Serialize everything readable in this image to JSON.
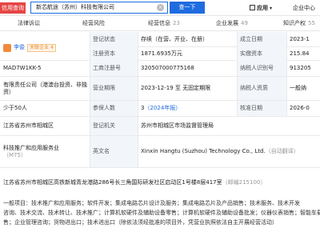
{
  "topbar": {
    "logo": "信用查询",
    "search_value": "新芯航途（苏州）科技有限公司",
    "clear_icon": "×",
    "search_button": "查一下",
    "app_label": "应用",
    "enterprise_center": "企业中心"
  },
  "tabs": [
    {
      "label": "法律诉讼",
      "count": ""
    },
    {
      "label": "经营风险",
      "count": ""
    },
    {
      "label": "经营信息",
      "count": "23"
    },
    {
      "label": "企业发展",
      "count": "49"
    },
    {
      "label": "知识产权",
      "count": "55"
    }
  ],
  "info": {
    "legal_rep": {
      "name": "李俊",
      "link": "关联企业",
      "count": "4"
    },
    "reg_status": {
      "label": "登记状态",
      "value": "存续（在营、开业、在册）"
    },
    "est_date": {
      "label": "成立日期",
      "value": "2023-1"
    },
    "reg_capital": {
      "label": "注册资本",
      "value": "1871.6935万元"
    },
    "paid_capital": {
      "label": "实缴资本",
      "value": "215.84"
    },
    "credit_code": "MAD7W1KK-5",
    "biz_reg_no": {
      "label": "工商注册号",
      "value": "320507000775168"
    },
    "taxpayer_id": {
      "label": "纳税人识别号",
      "value": "913205"
    },
    "company_type": "有限责任公司（港澳台投资、非独资）",
    "biz_term": {
      "label": "营业期限",
      "value": "2023-12-19 至 无固定期限"
    },
    "taxpayer_qual": {
      "label": "纳税人资质",
      "value": "一般纳"
    },
    "staff_size": "少于50人",
    "insured": {
      "label": "参保人数",
      "value": "3",
      "year": "（2024年报）"
    },
    "approval_date": {
      "label": "核准日期",
      "value": "2026-0"
    },
    "region": "江苏省苏州市相城区",
    "reg_authority": {
      "label": "登记机关",
      "value": "苏州市相城区市场监督管理局"
    },
    "industry_prefix": "科技推广和应用服务业",
    "industry_code": "（M75）",
    "en_name": {
      "label": "英文名",
      "value": "Xinxin Hangtu (Suzhou) Technology Co., Ltd.",
      "note": "（自动翻译）"
    },
    "address": "江苏省苏州市相城区高铁新城青龙港路286号长三角国际研发社区启动区1号楼8层417室",
    "postcode": "（邮编215100）"
  },
  "scope_lines": [
    "一般项目：技术推广和应用服务；软件开发；集成电路芯片设计及服务；集成电路芯片及产品销售；技术服务、技术开发",
    "咨询、技术交流、技术转让、技术推广；计算机软硬件及辅助设备零售；计算机软硬件及辅助设备批发；仪器仪表销售；智能车载设备",
    "售；企业管理咨询；货物进出口；技术进出口（除依法须经批准的项目外，凭营业执照依法自主开展经营活动）"
  ]
}
